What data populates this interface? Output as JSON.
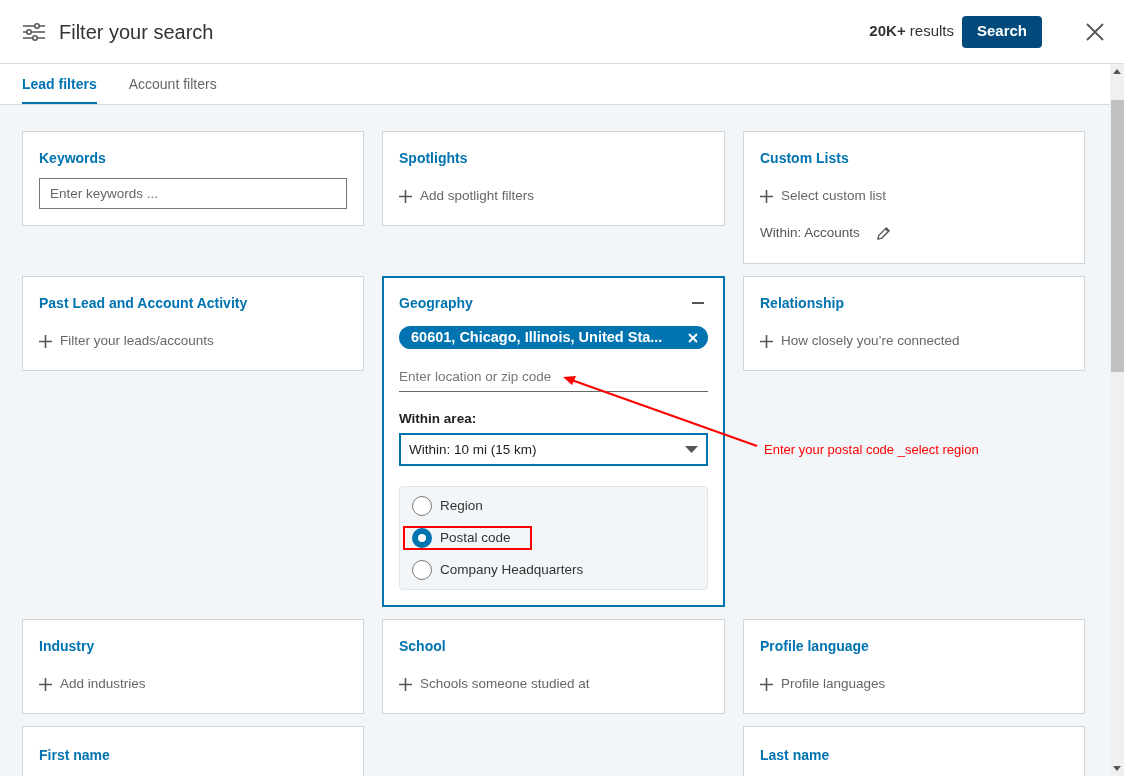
{
  "header": {
    "title": "Filter your search",
    "results": "**20K+** results",
    "search_button": "Search"
  },
  "tabs": [
    {
      "label": "Lead filters",
      "selected": true
    },
    {
      "label": "Account filters",
      "selected": false
    }
  ],
  "rows": [
    [
      {
        "kind": "input",
        "title": "Keywords",
        "placeholder": "Enter keywords ..."
      },
      {
        "kind": "add",
        "title": "Spotlights",
        "action": "Add spotlight filters"
      },
      {
        "kind": "custom",
        "title": "Custom Lists",
        "action": "Select custom list",
        "within": "Within: Accounts"
      }
    ],
    [
      {
        "kind": "add",
        "title": "Past Lead and Account Activity",
        "action": "Filter your leads/accounts"
      },
      {
        "kind": "geography",
        "title": "Geography",
        "expanded": true,
        "chip": "60601, Chicago, Illinois, United Sta...",
        "placeholder": "Enter location or zip code",
        "area_label": "Within area:",
        "area_value": "Within: 10 mi (15 km)",
        "options": [
          {
            "label": "Region",
            "selected": false,
            "highlighted": false
          },
          {
            "label": "Postal code",
            "selected": true,
            "highlighted": true
          },
          {
            "label": "Company Headquarters",
            "selected": false,
            "highlighted": false
          }
        ]
      },
      {
        "kind": "add",
        "title": "Relationship",
        "action": "How closely you’re connected"
      }
    ],
    [
      {
        "kind": "add",
        "title": "Industry",
        "action": "Add industries"
      },
      {
        "kind": "add",
        "title": "School",
        "action": "Schools someone studied at"
      },
      {
        "kind": "add",
        "title": "Profile language",
        "action": "Profile languages"
      }
    ],
    [
      {
        "kind": "title",
        "title": "First name"
      },
      {
        "kind": "empty"
      },
      {
        "kind": "title",
        "title": "Last name"
      }
    ]
  ],
  "annotation": {
    "text": "Enter your postal code _select region"
  }
}
